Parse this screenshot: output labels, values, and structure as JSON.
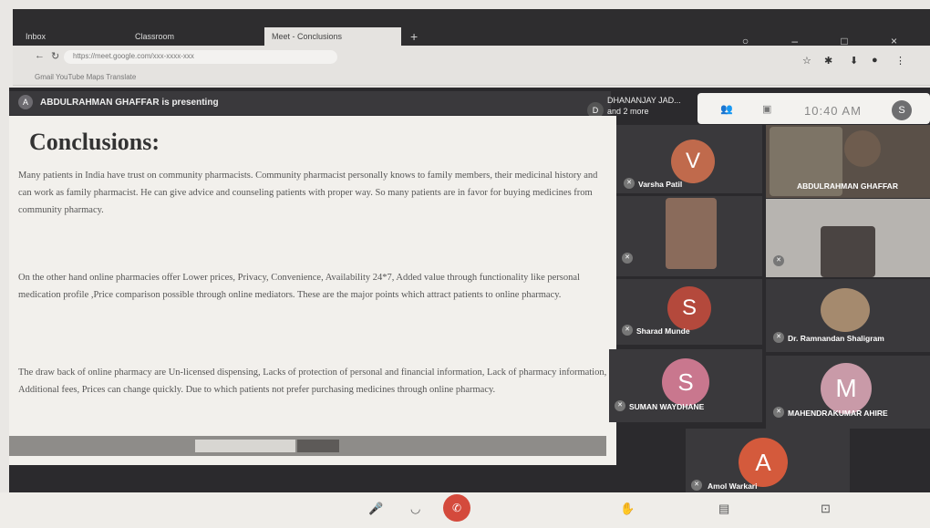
{
  "browser": {
    "tabs": [
      {
        "label": "Inbox"
      },
      {
        "label": "Classroom"
      },
      {
        "label": "Meet - Conclusions"
      }
    ],
    "new_tab": "+",
    "address": "https://meet.google.com/xxx-xxxx-xxx",
    "bookmarks": "Gmail   YouTube   Maps   Translate",
    "window_controls": "○ – □ ×"
  },
  "meeting": {
    "presenter_initial": "A",
    "presenting_label": "ABDULRAHMAN GHAFFAR is presenting",
    "pinned_initial": "D",
    "pinned_name": "DHANANJAY JAD...",
    "pinned_sub": "and 2 more",
    "clock": "10:40 AM",
    "self_initial": "S"
  },
  "slide": {
    "title": "Conclusions:",
    "para1": "Many patients in India have trust on community pharmacists. Community pharmacist personally knows to family members, their medicinal history and can work as family pharmacist. He can give advice and counseling patients with proper way. So many patients are in favor for buying medicines from community pharmacy.",
    "para2": "On the other hand online pharmacies offer Lower prices, Privacy, Convenience, Availability 24*7, Added value through functionality like personal medication profile ,Price comparison possible through online mediators. These are the major points which attract patients to online pharmacy.",
    "para3": "The draw back of online pharmacy are Un-licensed dispensing, Lacks of protection of personal and financial information, Lack of pharmacy information, Additional fees, Prices can change quickly. Due to which patients not prefer purchasing medicines through online pharmacy."
  },
  "participants": [
    {
      "name": "Varsha Patil",
      "initial": "V",
      "color": "#c06a4c"
    },
    {
      "name": "ABDULRAHMAN GHAFFAR",
      "initial": "",
      "color": "#5a4a3a"
    },
    {
      "name": "",
      "initial": "",
      "color": "#8a6b5b"
    },
    {
      "name": "",
      "initial": "",
      "color": "#9a9694"
    },
    {
      "name": "Sharad Munde",
      "initial": "S",
      "color": "#b4493c"
    },
    {
      "name": "Dr. Ramnandan Shaligram",
      "initial": "",
      "color": "#a58a6e"
    },
    {
      "name": "SUMAN WAYDHANE",
      "initial": "S",
      "color": "#c9778e"
    },
    {
      "name": "MAHENDRAKUMAR AHIRE",
      "initial": "M",
      "color": "#c99aa8"
    },
    {
      "name": "Amol Warkari",
      "initial": "A",
      "color": "#d45a3c"
    }
  ]
}
